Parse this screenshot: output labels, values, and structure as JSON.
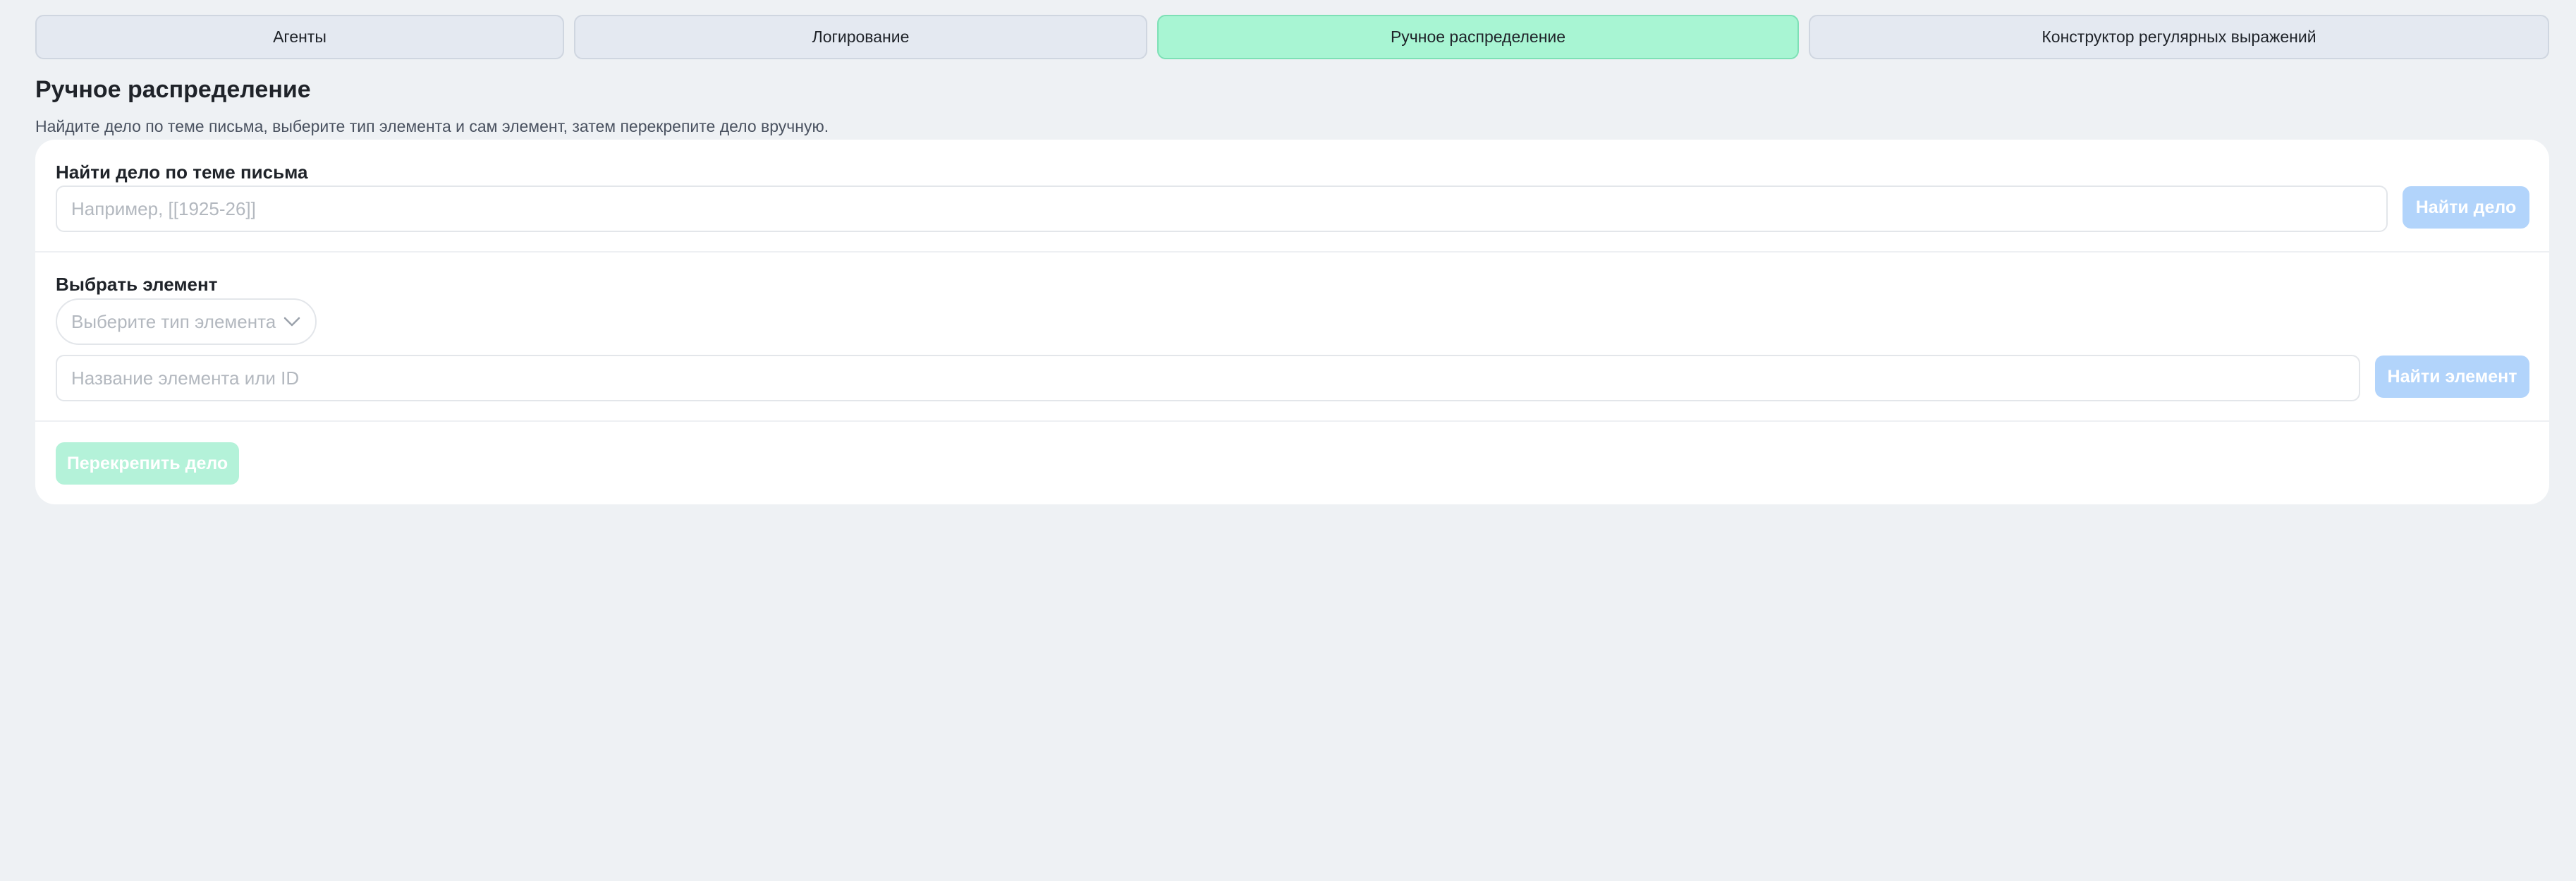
{
  "tabs": [
    {
      "label": "Агенты",
      "active": false
    },
    {
      "label": "Логирование",
      "active": false
    },
    {
      "label": "Ручное распределение",
      "active": true
    },
    {
      "label": "Конструктор регулярных выражений",
      "active": false
    }
  ],
  "page": {
    "title": "Ручное распределение",
    "description": "Найдите дело по теме письма, выберите тип элемента и сам элемент, затем перекрепите дело вручную."
  },
  "find_case": {
    "label": "Найти дело по теме письма",
    "placeholder": "Например, [[1925-26]]",
    "value": "",
    "button_label": "Найти дело"
  },
  "select_element": {
    "label": "Выбрать элемент",
    "type_placeholder": "Выберите тип элемента",
    "name_placeholder": "Название элемента или ID",
    "value": "",
    "button_label": "Найти элемент"
  },
  "reassign": {
    "button_label": "Перекрепить дело"
  },
  "colors": {
    "background": "#eef1f4",
    "active_tab": "#a8f5d3",
    "tab": "#e4e9f1",
    "primary_button_disabled": "#b2d4fb",
    "success_button_disabled": "#b4f2d9"
  },
  "icons": {
    "select_chevron": "chevron-down-icon"
  }
}
